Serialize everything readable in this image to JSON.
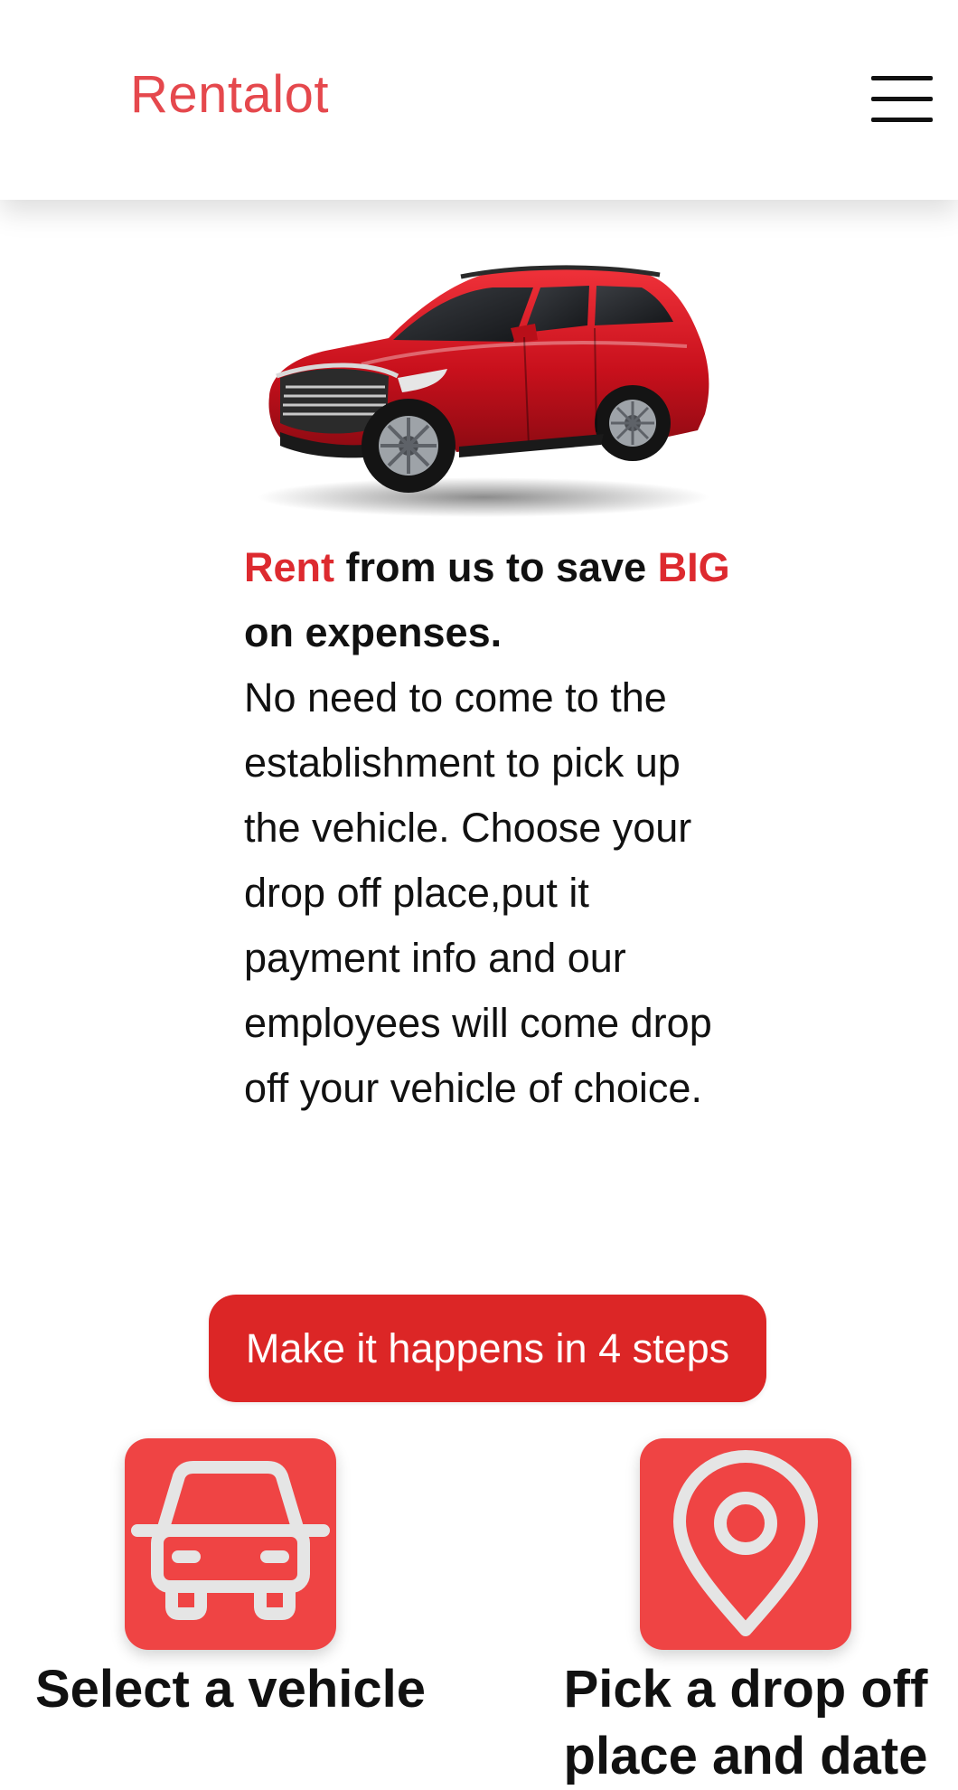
{
  "header": {
    "brand": "Rentalot",
    "menu_icon": "hamburger-menu-icon"
  },
  "hero": {
    "image": "red-suv-image"
  },
  "intro": {
    "headline_accent_1": "Rent",
    "headline_part_1": " from us to save ",
    "headline_accent_2": "BIG",
    "headline_part_2": " on expenses.",
    "body": "No need to come to the establishment to pick up the vehicle. Choose your drop off place,put it payment info and our employees will come drop off your vehicle of choice."
  },
  "cta": {
    "label": "Make it happens in 4 steps"
  },
  "steps": [
    {
      "icon": "car-icon",
      "title": "Select a vehicle"
    },
    {
      "icon": "location-pin-icon",
      "title": "Pick a drop off place and date"
    }
  ],
  "colors": {
    "brand": "#e5484d",
    "accent": "#dd2a2f",
    "button": "#dc2626",
    "tile": "#ef4444",
    "icon_stroke": "#e5e5e5"
  }
}
